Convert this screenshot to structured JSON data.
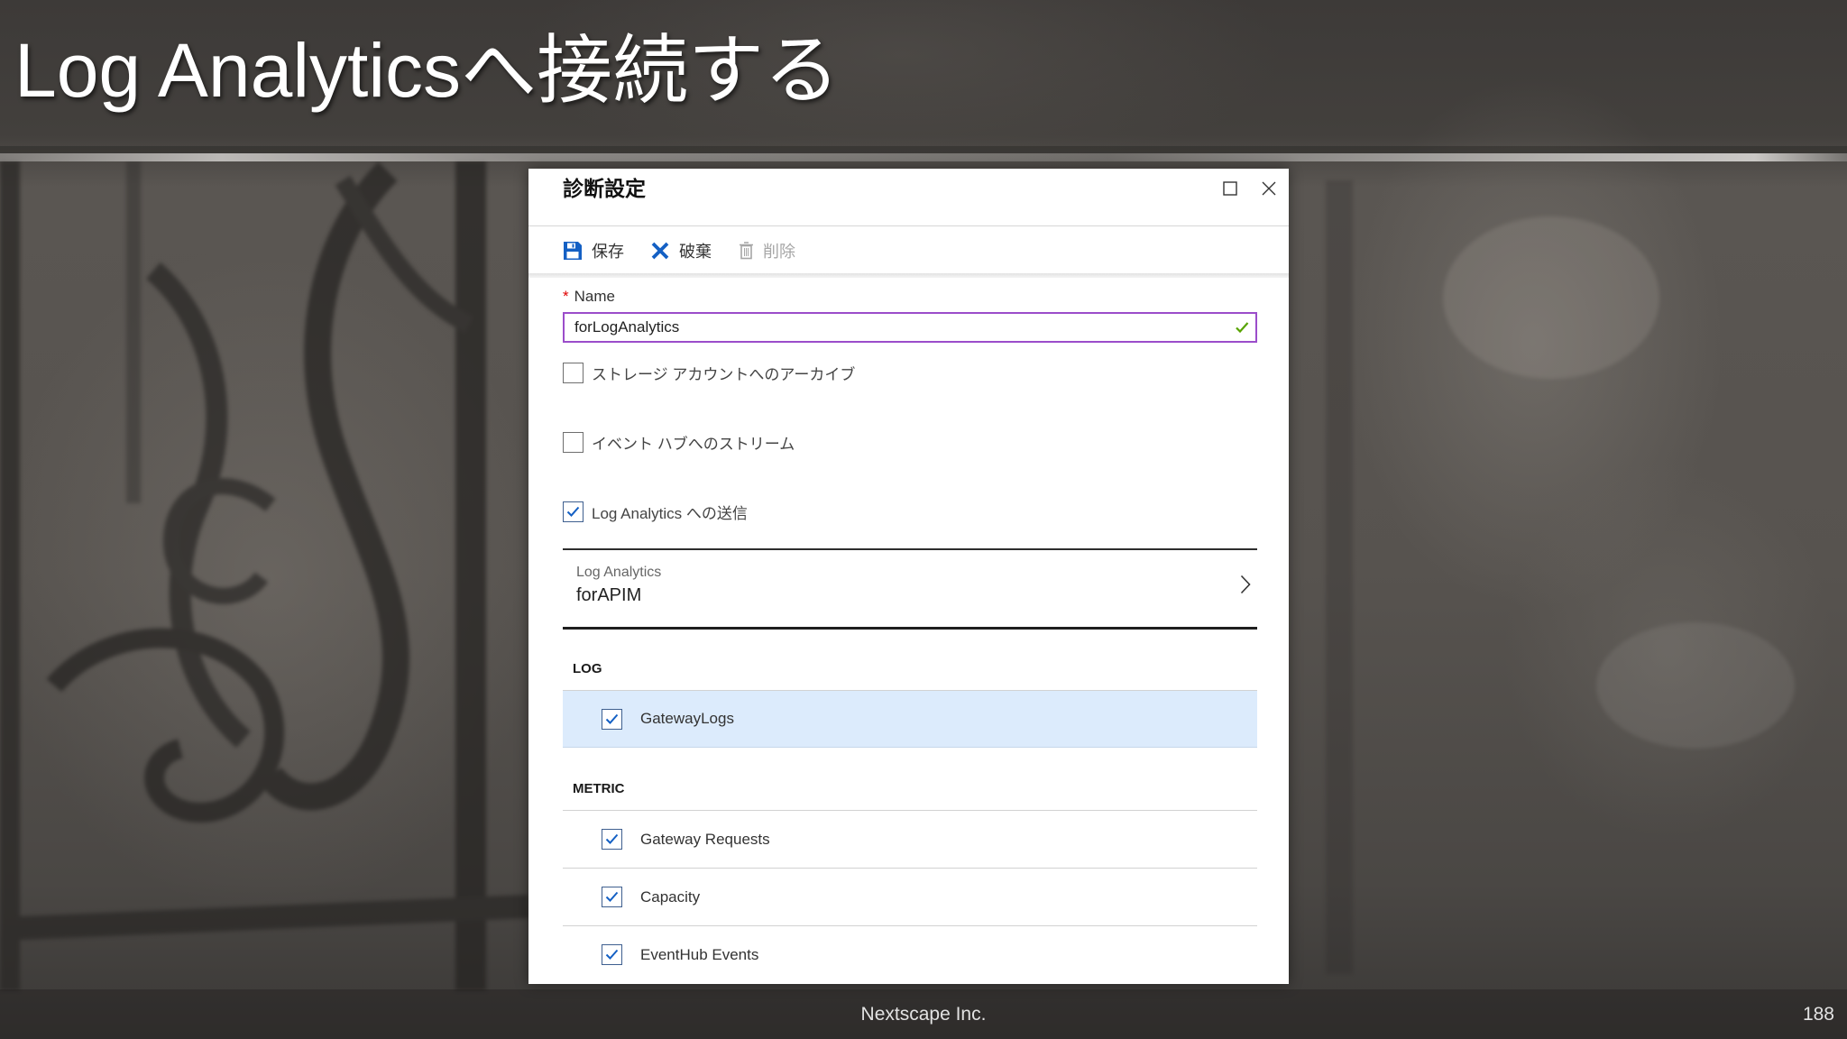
{
  "slide": {
    "title": "Log Analyticsへ接続する",
    "footer_text": "Nextscape Inc.",
    "page_number": "188"
  },
  "dialog": {
    "title": "診断設定",
    "window_controls": {
      "maximize_icon": "maximize-icon",
      "close_icon": "close-icon"
    },
    "toolbar": {
      "save": {
        "icon": "save-icon",
        "label": "保存",
        "disabled": false
      },
      "discard": {
        "icon": "discard-icon",
        "label": "破棄",
        "disabled": false
      },
      "delete": {
        "icon": "trash-icon",
        "label": "削除",
        "disabled": true
      }
    },
    "name_field": {
      "required_mark": "*",
      "label": "Name",
      "value": "forLogAnalytics",
      "valid": true
    },
    "destinations": [
      {
        "label": "ストレージ アカウントへのアーカイブ",
        "checked": false
      },
      {
        "label": "イベント ハブへのストリーム",
        "checked": false
      },
      {
        "label": "Log Analytics への送信",
        "checked": true
      }
    ],
    "workspace": {
      "label": "Log Analytics",
      "value": "forAPIM",
      "icon": "chevron-right-icon"
    },
    "log": {
      "header": "LOG",
      "items": [
        {
          "label": "GatewayLogs",
          "checked": true,
          "selected": true
        }
      ]
    },
    "metric": {
      "header": "METRIC",
      "items": [
        {
          "label": "Gateway Requests",
          "checked": true
        },
        {
          "label": "Capacity",
          "checked": true
        },
        {
          "label": "EventHub Events",
          "checked": true
        }
      ]
    }
  },
  "colors": {
    "accent": "#1460c4",
    "input_border": "#9b4dca",
    "valid_check": "#57a300",
    "selected_row": "#dcebfc",
    "required_mark": "#e00000",
    "disabled_text": "#a6a6a6"
  }
}
